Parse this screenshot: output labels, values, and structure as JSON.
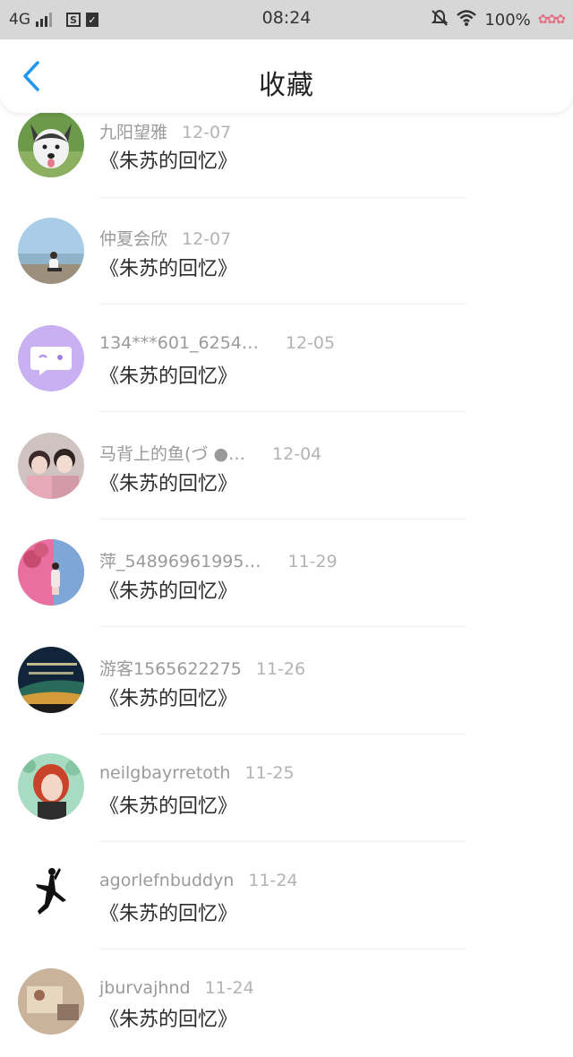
{
  "status_bar": {
    "network": "4G",
    "time": "08:24",
    "battery": "100%",
    "icons": [
      "signal-icon",
      "sim-icon",
      "clipboard-icon",
      "mute-icon",
      "wifi-icon",
      "flower-icon"
    ]
  },
  "header": {
    "back_icon": "chevron-left-icon",
    "title": "收藏"
  },
  "colors": {
    "accent": "#2196f3",
    "status_bar_bg": "#d7d7d7"
  },
  "items": [
    {
      "name": "九阳望雅",
      "date": "12-07",
      "book": "《朱苏的回忆》",
      "avatar": "husky-dog"
    },
    {
      "name": "仲夏会欣",
      "date": "12-07",
      "book": "《朱苏的回忆》",
      "avatar": "beach-person"
    },
    {
      "name": "134***601_6254…",
      "date": "12-05",
      "book": "《朱苏的回忆》",
      "avatar": "chat-bubble"
    },
    {
      "name": "马背上的鱼(づ ●…",
      "date": "12-04",
      "book": "《朱苏的回忆》",
      "avatar": "two-people"
    },
    {
      "name": "萍_54896961995…",
      "date": "11-29",
      "book": "《朱苏的回忆》",
      "avatar": "pink-wall"
    },
    {
      "name": "游客1565622275",
      "date": "11-26",
      "book": "《朱苏的回忆》",
      "avatar": "night-sky"
    },
    {
      "name": "neilgbayrretoth",
      "date": "11-25",
      "book": "《朱苏的回忆》",
      "avatar": "red-hair-girl"
    },
    {
      "name": "agorlefnbuddyn",
      "date": "11-24",
      "book": "《朱苏的回忆》",
      "avatar": "jumpman-logo"
    },
    {
      "name": "jburvajhnd",
      "date": "11-24",
      "book": "《朱苏的回忆》",
      "avatar": "still-life"
    }
  ]
}
